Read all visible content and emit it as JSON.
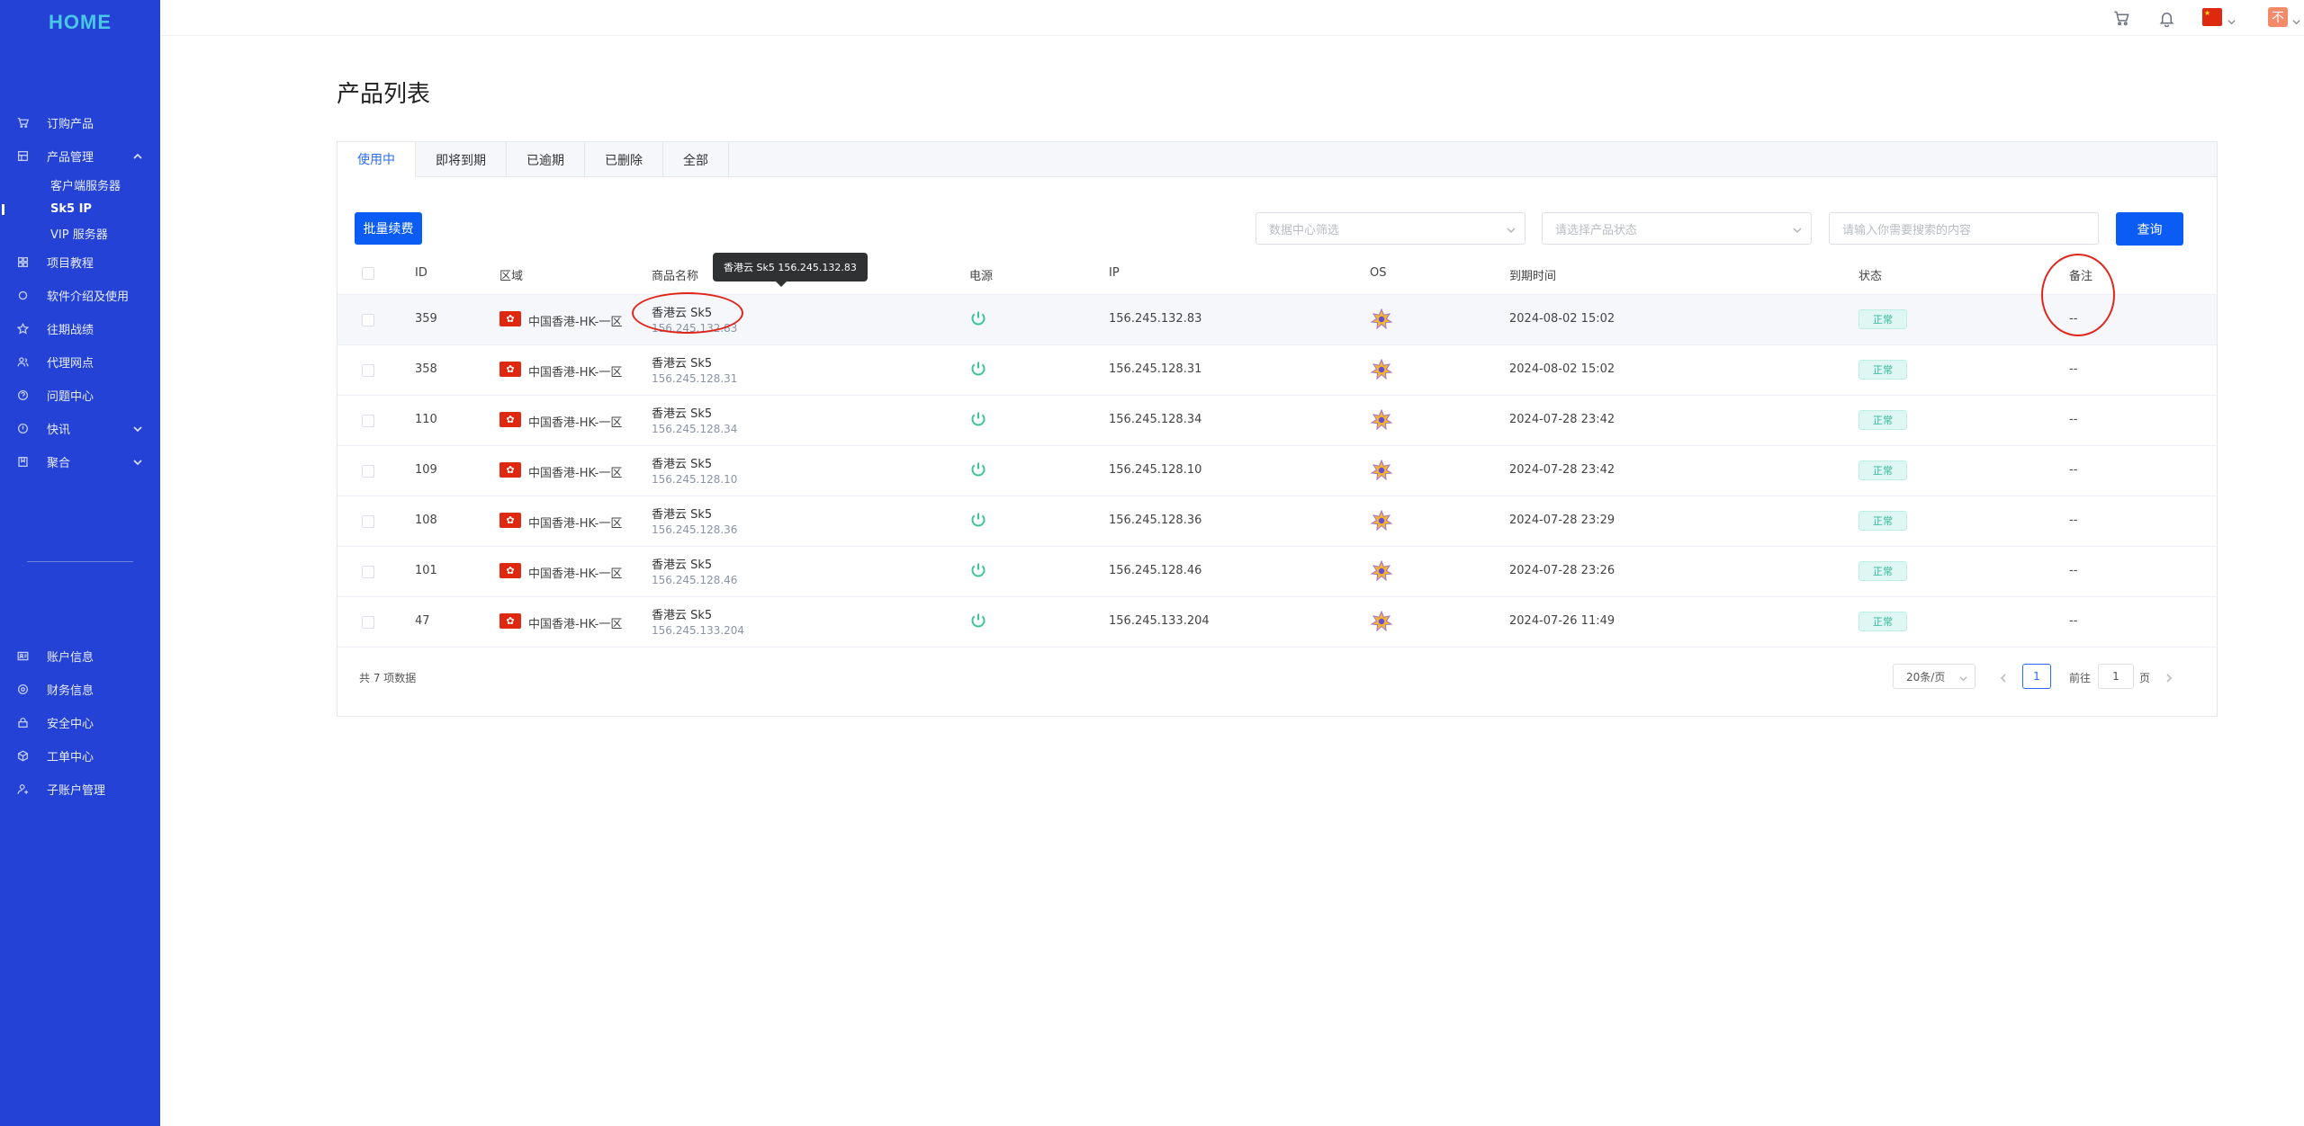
{
  "logo": "HOME",
  "sidebar": {
    "items": [
      {
        "label": "订购产品",
        "icon": "cart-icon"
      },
      {
        "label": "产品管理",
        "icon": "box-icon",
        "expanded": true,
        "children": [
          "客户端服务器",
          "Sk5 IP",
          "VIP 服务器"
        ],
        "active_child": "Sk5 IP"
      },
      {
        "label": "项目教程",
        "icon": "grid-icon"
      },
      {
        "label": "软件介绍及使用",
        "icon": "circle-icon"
      },
      {
        "label": "往期战绩",
        "icon": "star-icon"
      },
      {
        "label": "代理网点",
        "icon": "users-icon"
      },
      {
        "label": "问题中心",
        "icon": "question-icon"
      },
      {
        "label": "快讯",
        "icon": "alert-icon",
        "collapsible": true
      },
      {
        "label": "聚合",
        "icon": "bookmark-icon",
        "collapsible": true
      }
    ],
    "bottom_items": [
      {
        "label": "账户信息",
        "icon": "user-card-icon"
      },
      {
        "label": "财务信息",
        "icon": "finance-icon"
      },
      {
        "label": "安全中心",
        "icon": "lock-icon"
      },
      {
        "label": "工单中心",
        "icon": "ticket-icon"
      },
      {
        "label": "子账户管理",
        "icon": "sub-account-icon"
      }
    ]
  },
  "header": {
    "avatar_text": "不"
  },
  "page": {
    "title": "产品列表",
    "tabs": [
      "使用中",
      "即将到期",
      "已逾期",
      "已删除",
      "全部"
    ],
    "active_tab": "使用中",
    "batch_renew": "批量续费",
    "filter_datacenter_placeholder": "数据中心筛选",
    "filter_status_placeholder": "请选择产品状态",
    "search_placeholder": "请输入你需要搜索的内容",
    "query_button": "查询"
  },
  "table": {
    "columns": [
      "ID",
      "区域",
      "商品名称",
      "电源",
      "IP",
      "OS",
      "到期时间",
      "状态",
      "备注"
    ],
    "rows": [
      {
        "id": "359",
        "region": "中国香港-HK-一区",
        "name": "香港云 Sk5",
        "sub_ip": "156.245.132.83",
        "ip": "156.245.132.83",
        "expire": "2024-08-02 15:02",
        "status": "正常",
        "note": "--"
      },
      {
        "id": "358",
        "region": "中国香港-HK-一区",
        "name": "香港云 Sk5",
        "sub_ip": "156.245.128.31",
        "ip": "156.245.128.31",
        "expire": "2024-08-02 15:02",
        "status": "正常",
        "note": "--"
      },
      {
        "id": "110",
        "region": "中国香港-HK-一区",
        "name": "香港云 Sk5",
        "sub_ip": "156.245.128.34",
        "ip": "156.245.128.34",
        "expire": "2024-07-28 23:42",
        "status": "正常",
        "note": "--"
      },
      {
        "id": "109",
        "region": "中国香港-HK-一区",
        "name": "香港云 Sk5",
        "sub_ip": "156.245.128.10",
        "ip": "156.245.128.10",
        "expire": "2024-07-28 23:42",
        "status": "正常",
        "note": "--"
      },
      {
        "id": "108",
        "region": "中国香港-HK-一区",
        "name": "香港云 Sk5",
        "sub_ip": "156.245.128.36",
        "ip": "156.245.128.36",
        "expire": "2024-07-28 23:29",
        "status": "正常",
        "note": "--"
      },
      {
        "id": "101",
        "region": "中国香港-HK-一区",
        "name": "香港云 Sk5",
        "sub_ip": "156.245.128.46",
        "ip": "156.245.128.46",
        "expire": "2024-07-28 23:26",
        "status": "正常",
        "note": "--"
      },
      {
        "id": "47",
        "region": "中国香港-HK-一区",
        "name": "香港云 Sk5",
        "sub_ip": "156.245.133.204",
        "ip": "156.245.133.204",
        "expire": "2024-07-26 11:49",
        "status": "正常",
        "note": "--"
      }
    ]
  },
  "tooltip": "香港云 Sk5 156.245.132.83",
  "pagination": {
    "total": "共 7 项数据",
    "page_size": "20条/页",
    "current_page": "1",
    "goto_label": "前往",
    "goto_value": "1",
    "page_suffix": "页"
  },
  "colors": {
    "sidebar": "#2443d6",
    "primary": "#0a5cf5",
    "status_ok": "#2fb89a",
    "annotation": "#e0241b"
  }
}
